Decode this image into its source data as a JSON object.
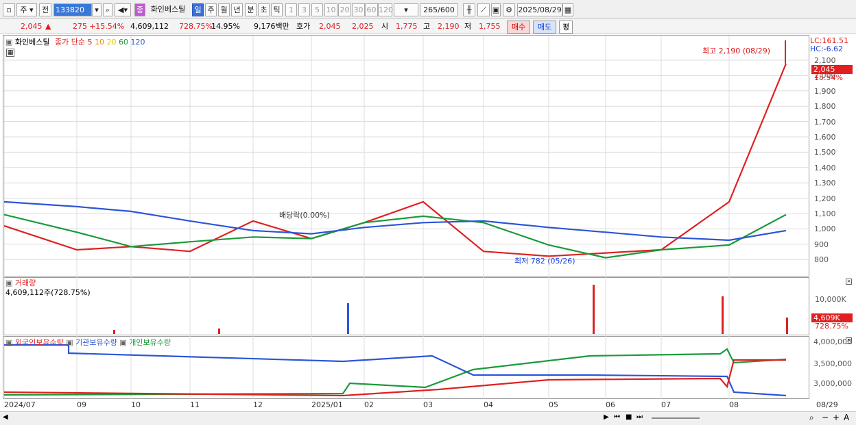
{
  "toolbar": {
    "type": "주",
    "prev": "전",
    "code": "133820",
    "stock_name": "화인베스틸",
    "stock_tag": "종",
    "periods": [
      "일",
      "주",
      "월",
      "년",
      "분",
      "초",
      "틱"
    ],
    "active_period": "일",
    "intervals": [
      "1",
      "3",
      "5",
      "10",
      "20",
      "30",
      "60",
      "120"
    ],
    "count": "265",
    "max": "/600",
    "date": "2025/08/29"
  },
  "quote": {
    "price": "2,045",
    "arrow": "▲",
    "change": "275",
    "pct": "+15.54%",
    "volume": "4,609,112",
    "vol_ratio": "728.75%",
    "turnover": "14.95%",
    "amount": "9,176백만",
    "ask_label": "호가",
    "ask": "2,045",
    "bid": "2,025",
    "open_label": "시",
    "open": "1,775",
    "high_label": "고",
    "high": "2,190",
    "low_label": "저",
    "low": "1,755",
    "buy": "매수",
    "sell": "매도",
    "eval": "평"
  },
  "price_panel": {
    "legend_name": "화인베스틸",
    "legend_ma": "종가 단순",
    "ma_periods": [
      {
        "label": "5",
        "color": "#e02020"
      },
      {
        "label": "10",
        "color": "#f08a00"
      },
      {
        "label": "20",
        "color": "#f0e000"
      },
      {
        "label": "60",
        "color": "#1a9a3a"
      },
      {
        "label": "120",
        "color": "#2b55d8"
      }
    ],
    "lc": "LC:161.51",
    "hc": "HC:-6.62",
    "high_note": "최고 2,190 (08/29)",
    "low_note": "최저 782 (05/26)",
    "div_note": "배당락(0.00%)",
    "price_tag": "2,045",
    "pct_tag": "15.54%",
    "y_ticks": [
      "2,100",
      "2,000",
      "1,900",
      "1,800",
      "1,700",
      "1,600",
      "1,500",
      "1,400",
      "1,300",
      "1,200",
      "1,100",
      "1,000",
      "900",
      "800"
    ]
  },
  "volume_panel": {
    "title": "거래량",
    "value": "4,609,112주(728.75%)",
    "y_tick": "10,000K",
    "tag": "4,609K",
    "tag_pct": "728.75%"
  },
  "holding_panel": {
    "foreign": "외국인보유수량",
    "inst": "기관보유수량",
    "indiv": "개인보유수량",
    "y_ticks": [
      "4,000,000",
      "3,500,000",
      "3,000,000"
    ]
  },
  "x_labels": [
    "2024/07",
    "09",
    "10",
    "11",
    "12",
    "2025/01",
    "02",
    "03",
    "04",
    "05",
    "06",
    "07",
    "08",
    "08/29"
  ],
  "chart_data": {
    "type": "line",
    "title": "화인베스틸",
    "x": [
      "2024/07",
      "09",
      "10",
      "11",
      "12",
      "2025/01",
      "02",
      "03",
      "04",
      "05",
      "06",
      "07",
      "08",
      "08/29"
    ],
    "series": [
      {
        "name": "5",
        "values": [
          1030,
          880,
          900,
          870,
          1060,
          950,
          1050,
          1180,
          870,
          840,
          860,
          880,
          1180,
          2045
        ]
      },
      {
        "name": "60",
        "values": [
          1100,
          990,
          900,
          930,
          960,
          950,
          1050,
          1090,
          1050,
          910,
          830,
          880,
          910,
          1100
        ]
      },
      {
        "name": "120",
        "values": [
          1180,
          1150,
          1120,
          1060,
          1000,
          980,
          1020,
          1050,
          1060,
          1020,
          990,
          960,
          940,
          1000
        ]
      }
    ],
    "ylim": [
      730,
      2160
    ],
    "high": 2190,
    "low": 782
  }
}
